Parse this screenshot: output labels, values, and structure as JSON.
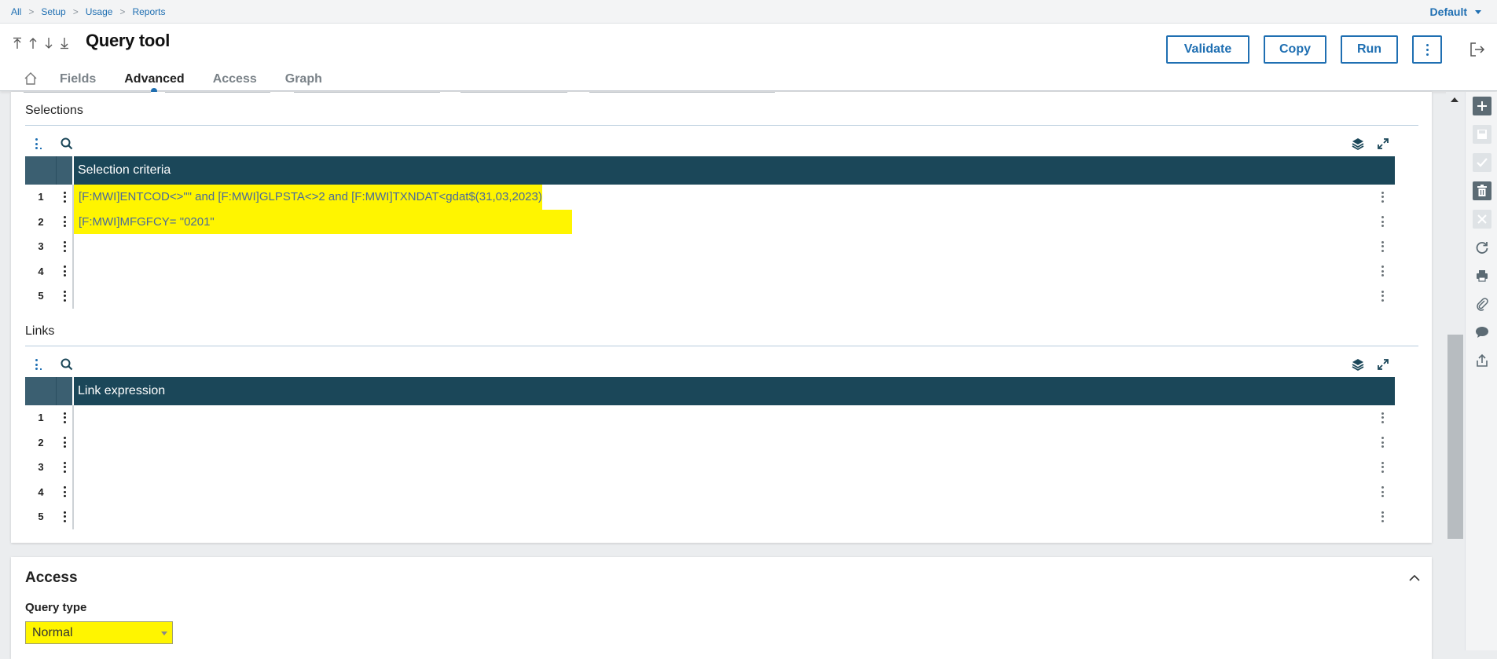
{
  "breadcrumb": [
    "All",
    "Setup",
    "Usage",
    "Reports"
  ],
  "folder_selector": "Default",
  "page_title": "Query tool",
  "actions": {
    "validate": "Validate",
    "copy": "Copy",
    "run": "Run"
  },
  "tabs": [
    {
      "label": "Fields",
      "active": false
    },
    {
      "label": "Advanced",
      "active": true
    },
    {
      "label": "Access",
      "active": false
    },
    {
      "label": "Graph",
      "active": false
    }
  ],
  "selections": {
    "title": "Selections",
    "column": "Selection criteria",
    "rows": [
      {
        "num": "1",
        "value": "[F:MWI]ENTCOD<>\"\" and [F:MWI]GLPSTA<>2 and [F:MWI]TXNDAT<gdat$(31,03,2023)"
      },
      {
        "num": "2",
        "value": "[F:MWI]MFGFCY= \"0201\""
      },
      {
        "num": "3",
        "value": ""
      },
      {
        "num": "4",
        "value": ""
      },
      {
        "num": "5",
        "value": ""
      }
    ]
  },
  "links": {
    "title": "Links",
    "column": "Link expression",
    "rows": [
      {
        "num": "1",
        "value": ""
      },
      {
        "num": "2",
        "value": ""
      },
      {
        "num": "3",
        "value": ""
      },
      {
        "num": "4",
        "value": ""
      },
      {
        "num": "5",
        "value": ""
      }
    ]
  },
  "access": {
    "title": "Access",
    "query_type_label": "Query type",
    "query_type_value": "Normal"
  },
  "colors": {
    "accent": "#1f6fb2",
    "grid_header": "#1b4759",
    "highlight": "#fff500"
  },
  "icons": [
    "arrow-first-icon",
    "arrow-up-icon",
    "arrow-down-icon",
    "arrow-last-icon",
    "more-vertical-icon",
    "exit-icon",
    "home-icon",
    "search-icon",
    "layers-icon",
    "expand-icon",
    "plus-icon",
    "save-icon",
    "check-icon",
    "trash-icon",
    "close-icon",
    "refresh-icon",
    "print-icon",
    "paperclip-icon",
    "comment-icon",
    "share-icon",
    "chevron-up-icon"
  ]
}
